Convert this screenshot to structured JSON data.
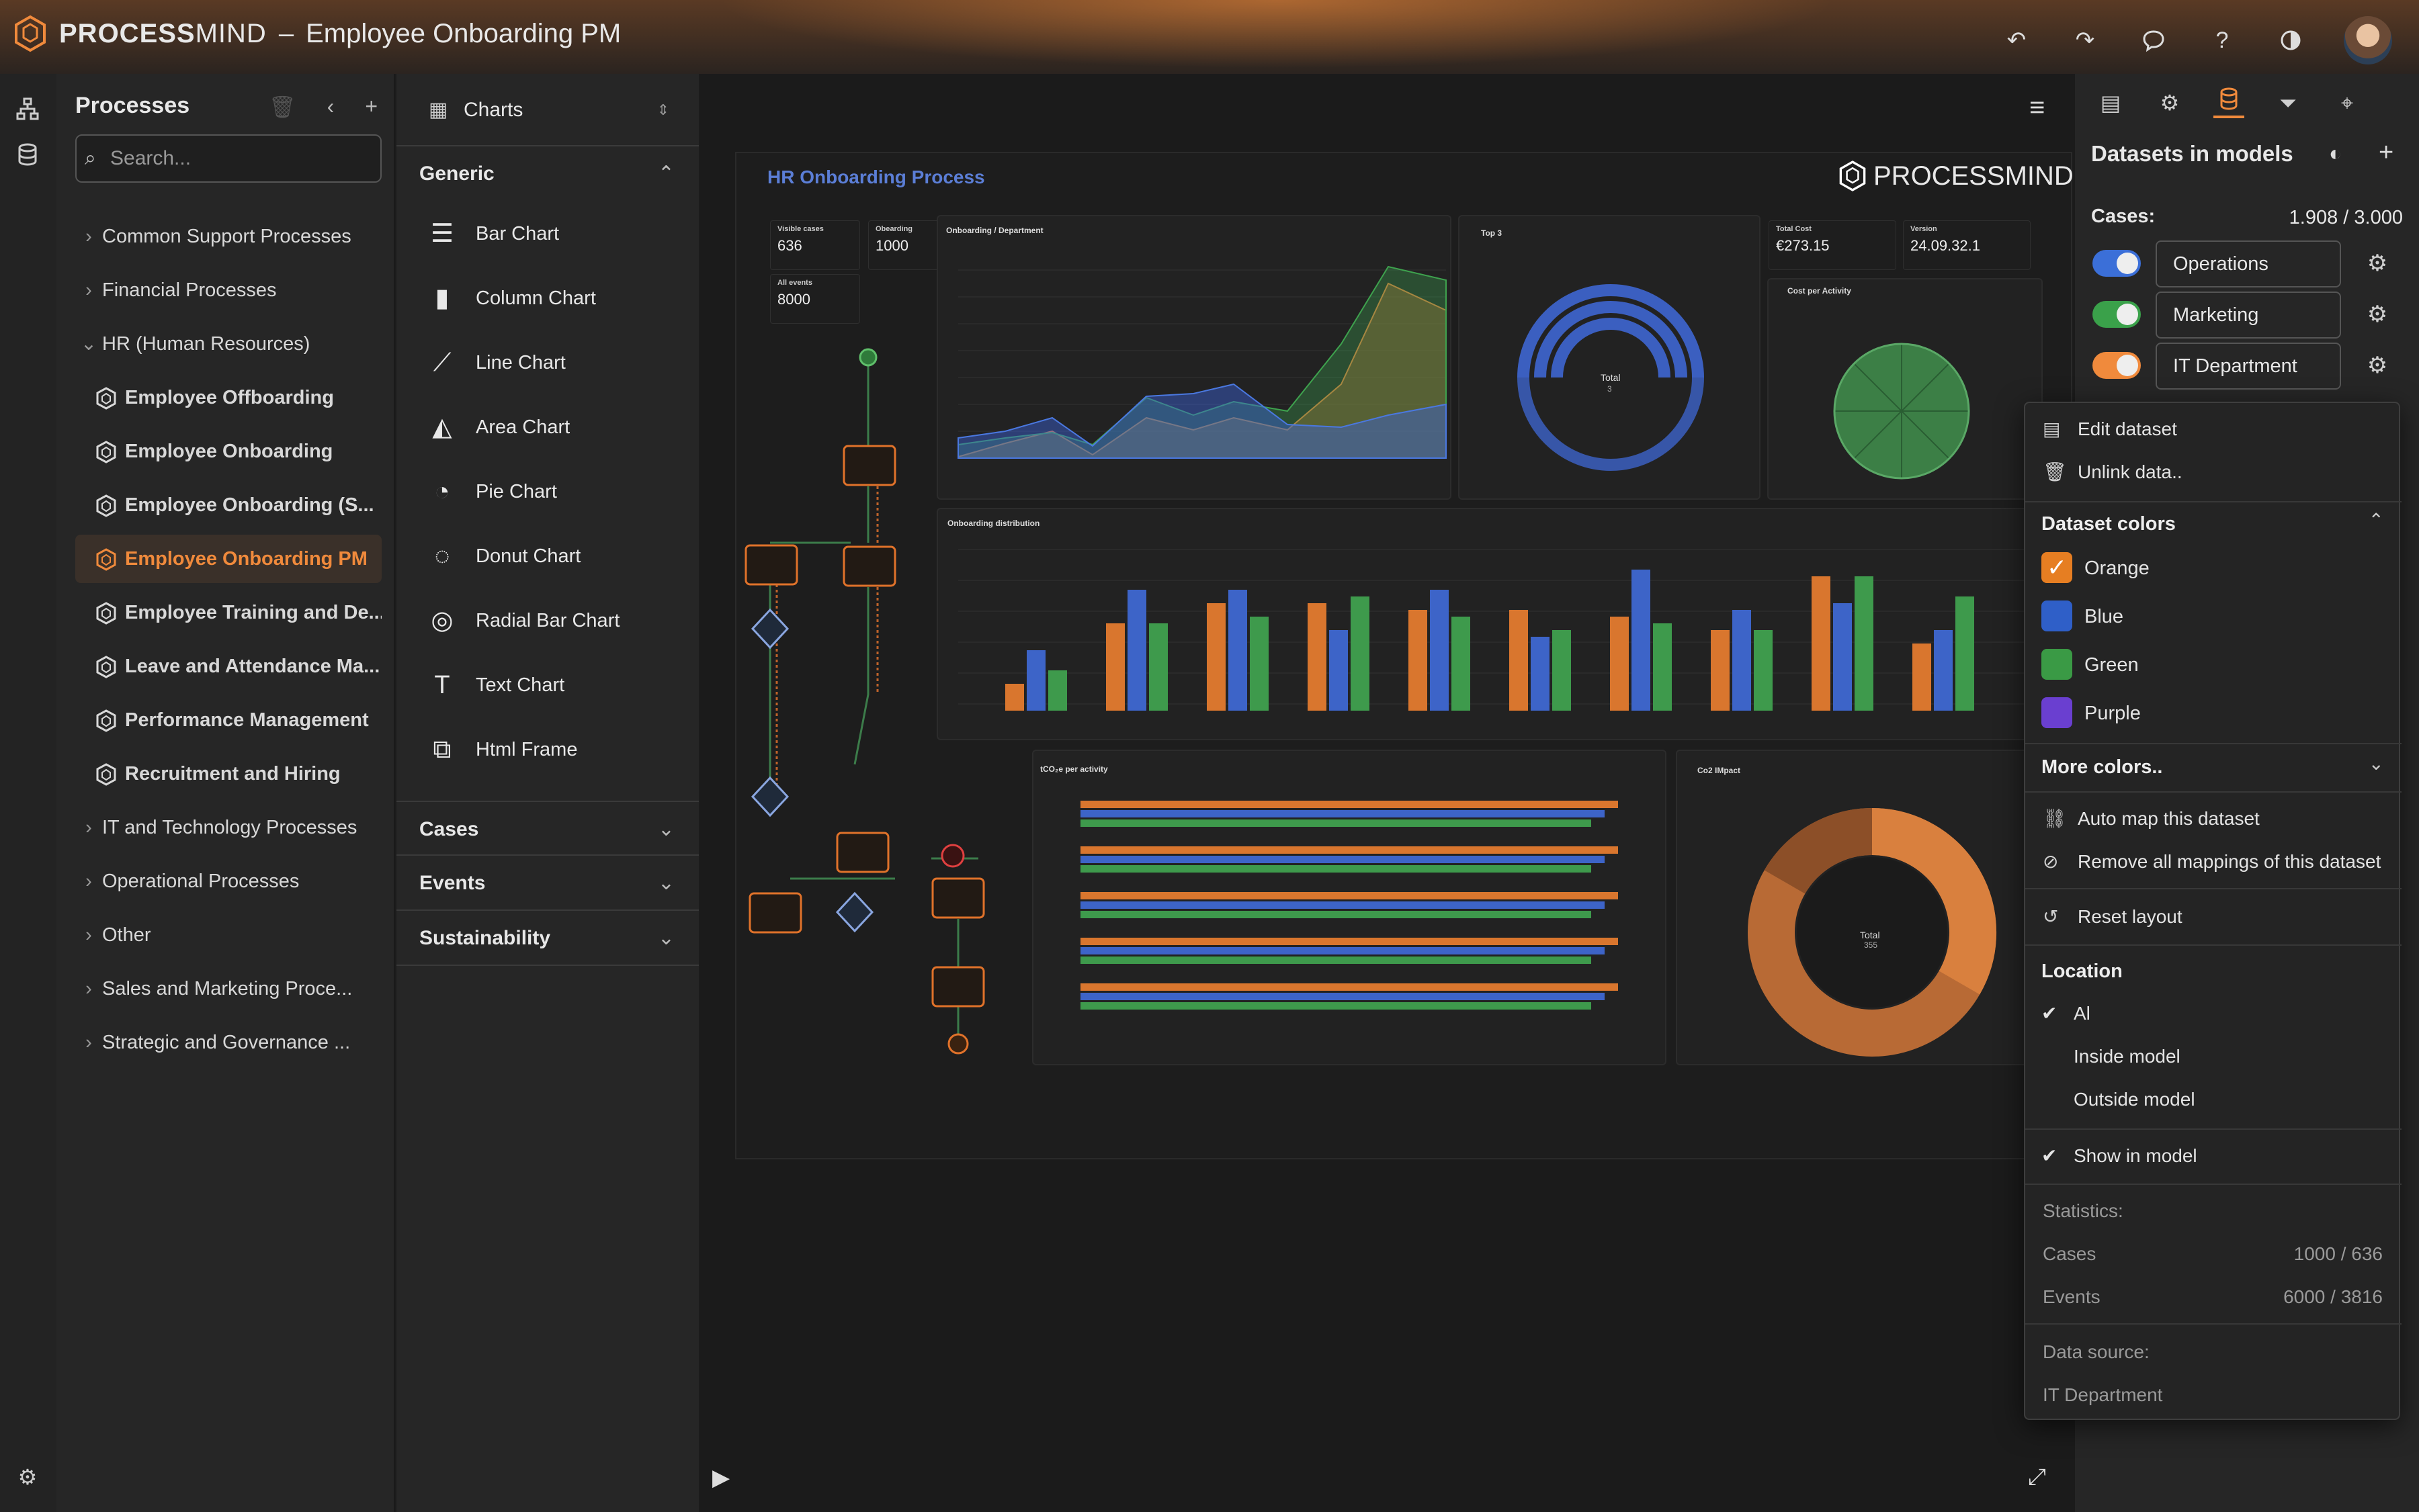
{
  "app": {
    "brand_bold": "PROCESS",
    "brand_thin": "MIND",
    "separator": "–",
    "title": "Employee Onboarding PM"
  },
  "processes": {
    "header": "Processes",
    "search_placeholder": "Search...",
    "items": [
      {
        "label": "Common Support Processes",
        "type": "folder",
        "expanded": false
      },
      {
        "label": "Financial Processes",
        "type": "folder",
        "expanded": false
      },
      {
        "label": "HR (Human Resources)",
        "type": "folder",
        "expanded": true
      },
      {
        "label": "Employee Offboarding",
        "type": "process"
      },
      {
        "label": "Employee Onboarding",
        "type": "process"
      },
      {
        "label": "Employee Onboarding (S...",
        "type": "process"
      },
      {
        "label": "Employee Onboarding PM",
        "type": "process",
        "selected": true
      },
      {
        "label": "Employee Training and De...",
        "type": "process"
      },
      {
        "label": "Leave and Attendance Ma...",
        "type": "process"
      },
      {
        "label": "Performance Management",
        "type": "process"
      },
      {
        "label": "Recruitment and Hiring",
        "type": "process"
      },
      {
        "label": "IT and Technology Processes",
        "type": "folder",
        "expanded": false
      },
      {
        "label": "Operational Processes",
        "type": "folder",
        "expanded": false
      },
      {
        "label": "Other",
        "type": "folder",
        "expanded": false
      },
      {
        "label": "Sales and Marketing Proce...",
        "type": "folder",
        "expanded": false
      },
      {
        "label": "Strategic and Governance ...",
        "type": "folder",
        "expanded": false
      }
    ]
  },
  "charts_panel": {
    "selector": "Charts",
    "generic": "Generic",
    "items": [
      {
        "label": "Bar Chart",
        "icon": "bar-chart-icon"
      },
      {
        "label": "Column Chart",
        "icon": "column-chart-icon"
      },
      {
        "label": "Line Chart",
        "icon": "line-chart-icon"
      },
      {
        "label": "Area Chart",
        "icon": "area-chart-icon"
      },
      {
        "label": "Pie Chart",
        "icon": "pie-chart-icon"
      },
      {
        "label": "Donut Chart",
        "icon": "donut-chart-icon"
      },
      {
        "label": "Radial Bar Chart",
        "icon": "radial-bar-chart-icon"
      },
      {
        "label": "Text Chart",
        "icon": "text-chart-icon"
      },
      {
        "label": "Html Frame",
        "icon": "html-frame-icon"
      }
    ],
    "sections": [
      "Cases",
      "Events",
      "Sustainability"
    ]
  },
  "dashboard": {
    "title": "HR Onboarding Process",
    "logo": "PROCESSMIND",
    "kpis": {
      "visible_cases_label": "Visible cases",
      "visible_cases": "636",
      "onboarding_label": "Obearding",
      "onboarding": "1000",
      "all_events_label": "All events",
      "all_events": "8000",
      "total_cost_label": "Total Cost",
      "total_cost": "€273.15",
      "version_label": "Version",
      "version": "24.09.32.1"
    },
    "panel_titles": {
      "line": "Onboarding / Department",
      "top3": "Top 3",
      "cost": "Cost per Activity",
      "dist": "Onboarding distribution",
      "tco2": "tCO₂e per activity",
      "co2": "Co2 IMpact"
    },
    "donut_total": "Total",
    "donut_total_value": "3",
    "co2_total": "Total",
    "co2_total_value": "355"
  },
  "right_panel": {
    "title": "Datasets in models",
    "cases_label": "Cases:",
    "cases_value": "1.908 / 3.000",
    "datasets": [
      {
        "name": "Operations",
        "color": "#3b6fd8"
      },
      {
        "name": "Marketing",
        "color": "#3aa14a"
      },
      {
        "name": "IT Department",
        "color": "#f08a3c"
      }
    ]
  },
  "menu": {
    "edit": "Edit dataset",
    "unlink": "Unlink data..",
    "colors_header": "Dataset colors",
    "colors": [
      {
        "name": "Orange",
        "hex": "#e67e22",
        "checked": true
      },
      {
        "name": "Blue",
        "hex": "#2f5fc8",
        "checked": false
      },
      {
        "name": "Green",
        "hex": "#3a9a45",
        "checked": false
      },
      {
        "name": "Purple",
        "hex": "#6a3fd0",
        "checked": false
      }
    ],
    "more_colors": "More colors..",
    "auto_map": "Auto map this dataset",
    "remove_mappings": "Remove all mappings of this dataset",
    "reset_layout": "Reset layout",
    "location_header": "Location",
    "loc_all": "Al",
    "loc_inside": "Inside model",
    "loc_outside": "Outside model",
    "show_in_model": "Show in model",
    "statistics": "Statistics:",
    "cases_label": "Cases",
    "cases_value": "1000 / 636",
    "events_label": "Events",
    "events_value": "6000 / 3816",
    "data_source_label": "Data source:",
    "data_source": "IT Department"
  }
}
